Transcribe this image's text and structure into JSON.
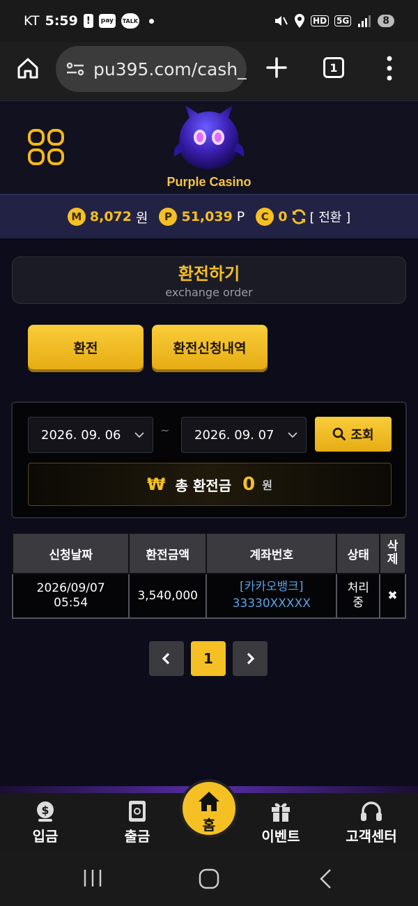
{
  "status_bar": {
    "carrier": "KT",
    "time": "5:59",
    "pay_badge": "pay",
    "talk_badge": "TALK",
    "network_hd": "HD",
    "network_5g": "5G",
    "battery": "8"
  },
  "browser": {
    "url": "pu395.com/cash_",
    "tab_count": "1"
  },
  "site": {
    "logo_text": "Purple Casino"
  },
  "balance": {
    "money_badge": "M",
    "money_value": "8,072",
    "money_unit": "원",
    "point_badge": "P",
    "point_value": "51,039",
    "point_unit": "P",
    "casino_badge": "C",
    "casino_value": "0",
    "switch_label": "[ 전환 ]"
  },
  "title": {
    "main": "환전하기",
    "sub": "exchange order"
  },
  "tabs": {
    "exchange": "환전",
    "history": "환전신청내역"
  },
  "search": {
    "date_from": "2026. 09. 06",
    "date_to": "2026. 09. 07",
    "separator": "~",
    "button": "조회"
  },
  "total": {
    "icon": "₩",
    "label": "총 환전금",
    "value": "0",
    "unit": "원"
  },
  "table": {
    "headers": [
      "신청날짜",
      "환전금액",
      "계좌번호",
      "상태",
      "삭제"
    ],
    "rows": [
      {
        "date": "2026/09/07",
        "time": "05:54",
        "amount": "3,540,000",
        "bank": "[카카오뱅크]",
        "account": "33330XXXXX",
        "status": "처리중",
        "delete": "✖"
      }
    ]
  },
  "pagination": {
    "current": "1"
  },
  "bottom_nav": {
    "deposit": "입금",
    "withdraw": "출금",
    "home": "홈",
    "event": "이벤트",
    "support": "고객센터"
  },
  "colors": {
    "accent_gold": "#f5c023",
    "link_blue": "#5aa3e6",
    "background": "#0c0c1a"
  }
}
